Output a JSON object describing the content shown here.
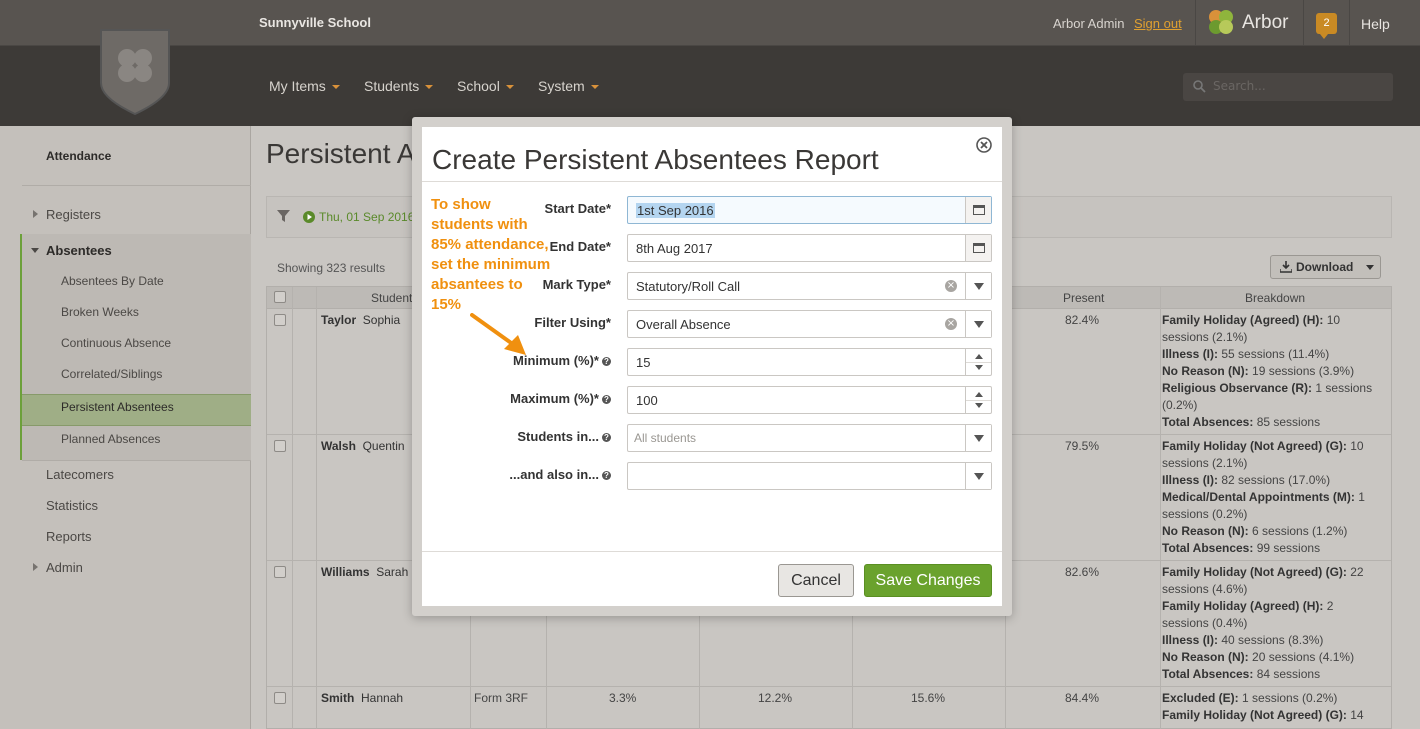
{
  "header": {
    "school_name": "Sunnyville School",
    "user_name": "Arbor Admin",
    "sign_out": "Sign out",
    "brand": "Arbor",
    "notification_count": "2",
    "help": "Help",
    "search_placeholder": "Search..."
  },
  "nav": {
    "items": [
      {
        "label": "My Items"
      },
      {
        "label": "Students"
      },
      {
        "label": "School"
      },
      {
        "label": "System"
      }
    ]
  },
  "sidebar": {
    "title": "Attendance",
    "items": [
      {
        "label": "Registers"
      },
      {
        "label": "Absentees"
      },
      {
        "label": "Latecomers"
      },
      {
        "label": "Statistics"
      },
      {
        "label": "Reports"
      },
      {
        "label": "Admin"
      }
    ],
    "sub_items": [
      {
        "label": "Absentees By Date"
      },
      {
        "label": "Broken Weeks"
      },
      {
        "label": "Continuous Absence"
      },
      {
        "label": "Correlated/Siblings"
      },
      {
        "label": "Persistent Absentees"
      },
      {
        "label": "Planned Absences"
      }
    ]
  },
  "main": {
    "title": "Persistent Absentees",
    "filter_date": "Thu, 01 Sep 2016",
    "showing": "Showing 323 results",
    "download": "Download",
    "columns": {
      "student": "Student",
      "present": "Present",
      "breakdown": "Breakdown"
    },
    "rows": [
      {
        "last": "Taylor",
        "first": "Sophia",
        "form": "",
        "c1": "",
        "c2": "",
        "c3": "",
        "present": "82.4%",
        "breakdown": [
          {
            "label": "Family Holiday (Agreed) (H):",
            "value": "10 sessions (2.1%)"
          },
          {
            "label": "Illness (I):",
            "value": "55 sessions (11.4%)"
          },
          {
            "label": "No Reason (N):",
            "value": "19 sessions (3.9%)"
          },
          {
            "label": "Religious Observance (R):",
            "value": "1 sessions (0.2%)"
          },
          {
            "label": "Total Absences:",
            "value": "85 sessions"
          }
        ]
      },
      {
        "last": "Walsh",
        "first": "Quentin",
        "form": "",
        "c1": "",
        "c2": "",
        "c3": "",
        "present": "79.5%",
        "breakdown": [
          {
            "label": "Family Holiday (Not Agreed) (G):",
            "value": "10 sessions (2.1%)"
          },
          {
            "label": "Illness (I):",
            "value": "82 sessions (17.0%)"
          },
          {
            "label": "Medical/Dental Appointments (M):",
            "value": "1 sessions (0.2%)"
          },
          {
            "label": "No Reason (N):",
            "value": "6 sessions (1.2%)"
          },
          {
            "label": "Total Absences:",
            "value": "99 sessions"
          }
        ]
      },
      {
        "last": "Williams",
        "first": "Sarah",
        "form": "",
        "c1": "",
        "c2": "",
        "c3": "",
        "present": "82.6%",
        "breakdown": [
          {
            "label": "Family Holiday (Not Agreed) (G):",
            "value": "22 sessions (4.6%)"
          },
          {
            "label": "Family Holiday (Agreed) (H):",
            "value": "2 sessions (0.4%)"
          },
          {
            "label": "Illness (I):",
            "value": "40 sessions (8.3%)"
          },
          {
            "label": "No Reason (N):",
            "value": "20 sessions (4.1%)"
          },
          {
            "label": "Total Absences:",
            "value": "84 sessions"
          }
        ]
      },
      {
        "last": "Smith",
        "first": "Hannah",
        "form": "Form 3RF",
        "c1": "3.3%",
        "c2": "12.2%",
        "c3": "15.6%",
        "present": "84.4%",
        "breakdown": [
          {
            "label": "Excluded (E):",
            "value": "1 sessions (0.2%)"
          },
          {
            "label": "Family Holiday (Not Agreed) (G):",
            "value": "14"
          }
        ]
      }
    ]
  },
  "modal": {
    "title": "Create Persistent Absentees Report",
    "note": "To show students with 85% attendance, set the minimum absantees to 15%",
    "fields": {
      "start_date": {
        "label": "Start Date*",
        "value": "1st Sep 2016"
      },
      "end_date": {
        "label": "End Date*",
        "value": "8th Aug 2017"
      },
      "mark_type": {
        "label": "Mark Type*",
        "value": "Statutory/Roll Call"
      },
      "filter_using": {
        "label": "Filter Using*",
        "value": "Overall Absence"
      },
      "minimum": {
        "label": "Minimum (%)*",
        "value": "15"
      },
      "maximum": {
        "label": "Maximum (%)*",
        "value": "100"
      },
      "students_in": {
        "label": "Students in...",
        "placeholder": "All students"
      },
      "also_in": {
        "label": "...and also in...",
        "value": ""
      }
    },
    "cancel": "Cancel",
    "save": "Save Changes"
  },
  "colors": {
    "header": "#585450",
    "nav": "#3d3a37",
    "accent_orange": "#f0900f",
    "save_green": "#6aa22d"
  }
}
